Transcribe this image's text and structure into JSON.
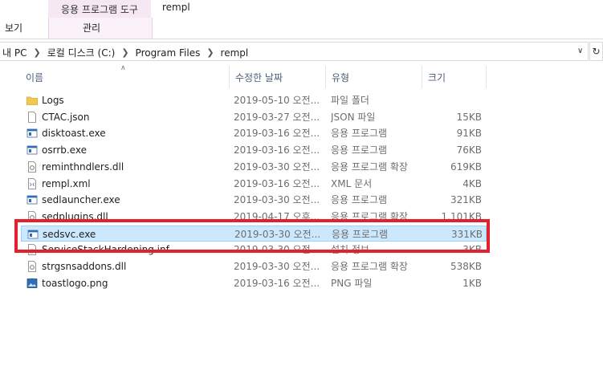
{
  "ribbon": {
    "contextual_tab": "응용 프로그램 도구",
    "title": "rempl",
    "tab_view": "보기",
    "tab_manage": "관리"
  },
  "address": {
    "crumbs": [
      "내 PC",
      "로컬 디스크 (C:)",
      "Program Files",
      "rempl"
    ]
  },
  "columns": {
    "name": "이름",
    "date": "수정한 날짜",
    "type": "유형",
    "size": "크기"
  },
  "files": [
    {
      "name": "Logs",
      "date": "2019-05-10 오전...",
      "type": "파일 폴더",
      "size": "",
      "icon": "folder-icon"
    },
    {
      "name": "CTAC.json",
      "date": "2019-03-27 오전...",
      "type": "JSON 파일",
      "size": "15KB",
      "icon": "file-icon"
    },
    {
      "name": "disktoast.exe",
      "date": "2019-03-16 오전...",
      "type": "응용 프로그램",
      "size": "91KB",
      "icon": "exe-icon"
    },
    {
      "name": "osrrb.exe",
      "date": "2019-03-16 오전...",
      "type": "응용 프로그램",
      "size": "76KB",
      "icon": "exe-icon"
    },
    {
      "name": "reminthndlers.dll",
      "date": "2019-03-30 오전...",
      "type": "응용 프로그램 확장",
      "size": "619KB",
      "icon": "dll-icon"
    },
    {
      "name": "rempl.xml",
      "date": "2019-03-16 오전...",
      "type": "XML 문서",
      "size": "4KB",
      "icon": "xml-icon"
    },
    {
      "name": "sedlauncher.exe",
      "date": "2019-03-30 오전...",
      "type": "응용 프로그램",
      "size": "321KB",
      "icon": "exe-icon"
    },
    {
      "name": "sedplugins.dll",
      "date": "2019-04-17 오후...",
      "type": "응용 프로그램 확장",
      "size": "1,101KB",
      "icon": "dll-icon"
    },
    {
      "name": "sedsvc.exe",
      "date": "2019-03-30 오전...",
      "type": "응용 프로그램",
      "size": "331KB",
      "icon": "exe-icon",
      "selected": true
    },
    {
      "name": "ServiceStackHardening.inf",
      "date": "2019-03-30 오전...",
      "type": "설치 정보",
      "size": "3KB",
      "icon": "inf-icon"
    },
    {
      "name": "strgsnsaddons.dll",
      "date": "2019-03-30 오전...",
      "type": "응용 프로그램 확장",
      "size": "538KB",
      "icon": "dll-icon"
    },
    {
      "name": "toastlogo.png",
      "date": "2019-03-16 오전...",
      "type": "PNG 파일",
      "size": "1KB",
      "icon": "image-icon"
    }
  ],
  "colors": {
    "selection": "#cce8ff",
    "highlight_box": "#e3202d",
    "contextual_tab": "#f6e8f3"
  }
}
